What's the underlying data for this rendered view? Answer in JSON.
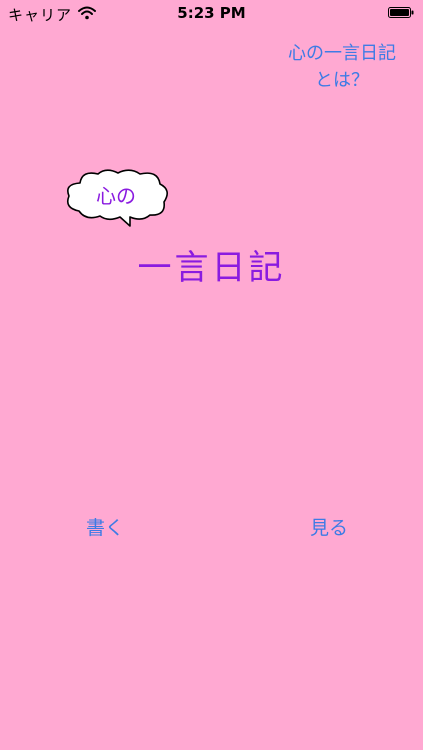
{
  "status_bar": {
    "carrier": "キャリア",
    "time": "5:23 PM"
  },
  "header": {
    "about_line1": "心の一言日記",
    "about_line2": "とは？"
  },
  "logo": {
    "bubble_text": "心の",
    "title": "一言日記"
  },
  "actions": {
    "write_label": "書く",
    "view_label": "見る"
  },
  "colors": {
    "background": "#FFA9D2",
    "accent_link": "#3D7BE5",
    "title": "#8A1BE0"
  }
}
